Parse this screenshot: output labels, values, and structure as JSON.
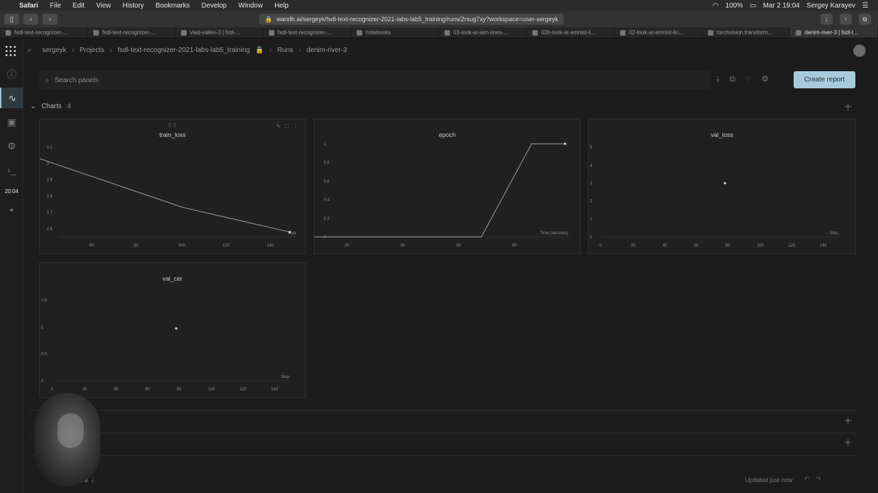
{
  "menubar": {
    "apple": "",
    "items": [
      "Safari",
      "File",
      "Edit",
      "View",
      "History",
      "Bookmarks",
      "Develop",
      "Window",
      "Help"
    ],
    "battery": "100%",
    "datetime": "Mar 2  19:04",
    "user": "Sergey Karayev"
  },
  "browser": {
    "url": "wandb.ai/sergeyk/fsdl-text-recognizer-2021-labs-lab5_training/runs/2rsug7xy?workspace=user-sergeyk",
    "tabs": [
      {
        "label": "fsdl-text-recognizer-..."
      },
      {
        "label": "fsdl-text-recognizer-..."
      },
      {
        "label": "vlad-valiev-2 | fsdl-..."
      },
      {
        "label": "fsdl-text-recognizer-..."
      },
      {
        "label": "notebooks"
      },
      {
        "label": "03-look-at-iam-lines-..."
      },
      {
        "label": "02b-look-at-emnist-li..."
      },
      {
        "label": "02-look-at-emnist-lin..."
      },
      {
        "label": "torchvision.transform..."
      },
      {
        "label": "denim-river-3 | fsdl-t..."
      }
    ]
  },
  "rail": {
    "time": "20:04"
  },
  "header": {
    "crumbs": [
      "sergeyk",
      "Projects",
      "fsdl-text-recognizer-2021-labs-lab5_training",
      "Runs",
      "denim-river-3"
    ]
  },
  "search": {
    "placeholder": "Search panels"
  },
  "toolbar": {
    "create_report": "Create report"
  },
  "section": {
    "title": "Charts",
    "count": "4"
  },
  "footer": {
    "workspace": "space",
    "updated": "Updated just now"
  },
  "chart_data": [
    {
      "type": "line",
      "title": "train_loss",
      "xlabel": "Step",
      "x": [
        21,
        101,
        149
      ],
      "y": [
        3.1,
        2.73,
        2.58
      ],
      "xticks": [
        "60",
        "80",
        "100",
        "120",
        "140"
      ],
      "yticks": [
        "3.1",
        "3",
        "2.9",
        "2.8",
        "2.7",
        "2.6"
      ]
    },
    {
      "type": "line",
      "title": "epoch",
      "xlabel": "Time (seconds)",
      "x": [
        23,
        54,
        63,
        69
      ],
      "y": [
        0,
        0,
        1,
        1
      ],
      "xticks": [
        "30",
        "40",
        "50",
        "60"
      ],
      "yticks": [
        "0",
        "0.2",
        "0.4",
        "0.6",
        "0.8",
        "1"
      ]
    },
    {
      "type": "scatter",
      "title": "val_loss",
      "xlabel": "Step",
      "x": [
        78
      ],
      "y": [
        3
      ],
      "xticks": [
        "0",
        "20",
        "40",
        "60",
        "80",
        "100",
        "120",
        "140"
      ],
      "yticks": [
        "0",
        "1",
        "2",
        "3",
        "4",
        "5"
      ]
    },
    {
      "type": "scatter",
      "title": "val_cer",
      "xlabel": "Step",
      "x": [
        78
      ],
      "y": [
        0.97
      ],
      "xticks": [
        "0",
        "20",
        "40",
        "60",
        "80",
        "100",
        "120",
        "140"
      ],
      "yticks": [
        "0",
        "0.5",
        "1",
        "1.5"
      ]
    }
  ]
}
